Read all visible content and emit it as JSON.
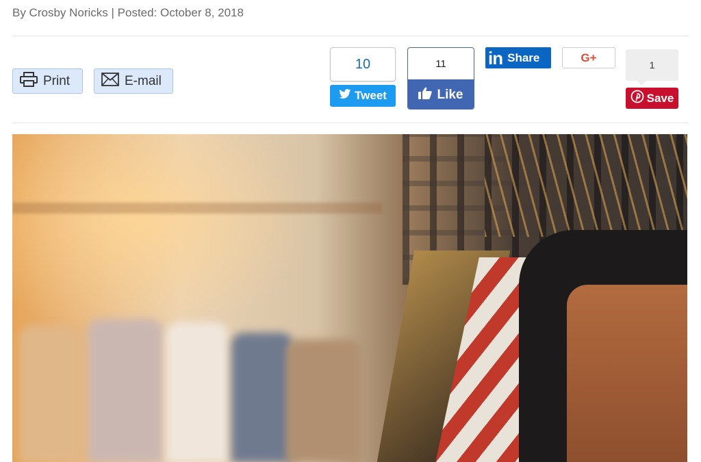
{
  "article": {
    "byline": "By Crosby Noricks | Posted: October 8, 2018"
  },
  "tools": {
    "print_label": "Print",
    "email_label": "E-mail"
  },
  "share": {
    "twitter": {
      "count": "10",
      "label": "Tweet"
    },
    "facebook": {
      "count": "11",
      "label": "Like"
    },
    "linkedin": {
      "logo": "in",
      "label": "Share"
    },
    "googleplus": {
      "label": "G+"
    },
    "pinterest": {
      "count": "1",
      "label": "Save"
    }
  },
  "colors": {
    "twitter": "#1d9bf0",
    "facebook": "#4267b2",
    "linkedin": "#0a66c2",
    "googleplus": "#dd4b39",
    "pinterest": "#c8102e",
    "tool_button_bg": "#dce9fb"
  },
  "icons": {
    "print": "printer-icon",
    "email": "envelope-icon",
    "twitter": "twitter-bird-icon",
    "facebook": "thumbs-up-icon",
    "pinterest": "pinterest-icon"
  }
}
